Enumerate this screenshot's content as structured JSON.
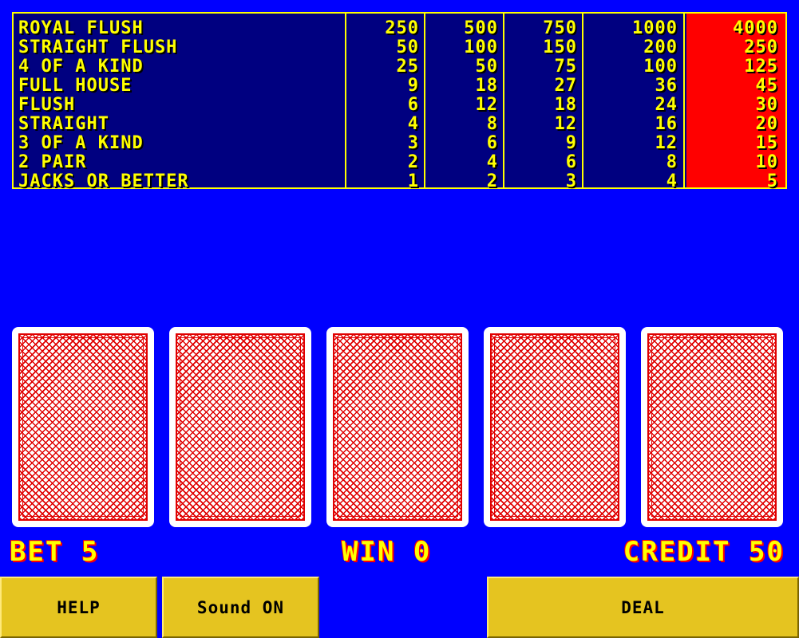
{
  "paytable": {
    "rows": [
      {
        "hand": "ROYAL FLUSH",
        "payouts": [
          "250",
          "500",
          "750",
          "1000",
          "4000"
        ]
      },
      {
        "hand": "STRAIGHT FLUSH",
        "payouts": [
          "50",
          "100",
          "150",
          "200",
          "250"
        ]
      },
      {
        "hand": "4 OF A KIND",
        "payouts": [
          "25",
          "50",
          "75",
          "100",
          "125"
        ]
      },
      {
        "hand": "FULL HOUSE",
        "payouts": [
          "9",
          "18",
          "27",
          "36",
          "45"
        ]
      },
      {
        "hand": "FLUSH",
        "payouts": [
          "6",
          "12",
          "18",
          "24",
          "30"
        ]
      },
      {
        "hand": "STRAIGHT",
        "payouts": [
          "4",
          "8",
          "12",
          "16",
          "20"
        ]
      },
      {
        "hand": "3 OF A KIND",
        "payouts": [
          "3",
          "6",
          "9",
          "12",
          "15"
        ]
      },
      {
        "hand": "2 PAIR",
        "payouts": [
          "2",
          "4",
          "6",
          "8",
          "10"
        ]
      },
      {
        "hand": "JACKS OR BETTER",
        "payouts": [
          "1",
          "2",
          "3",
          "4",
          "5"
        ]
      }
    ],
    "highlighted_column": 5
  },
  "cards": [
    {
      "state": "face-down"
    },
    {
      "state": "face-down"
    },
    {
      "state": "face-down"
    },
    {
      "state": "face-down"
    },
    {
      "state": "face-down"
    }
  ],
  "status": {
    "bet": "BET 5",
    "win": "WIN 0",
    "credit": "CREDIT 50"
  },
  "buttons": {
    "help": "HELP",
    "sound": "Sound ON",
    "deal": "DEAL"
  },
  "colors": {
    "background": "#0000ff",
    "text": "#ffff00",
    "highlight_column": "#ff0000",
    "button": "#e5c420"
  }
}
